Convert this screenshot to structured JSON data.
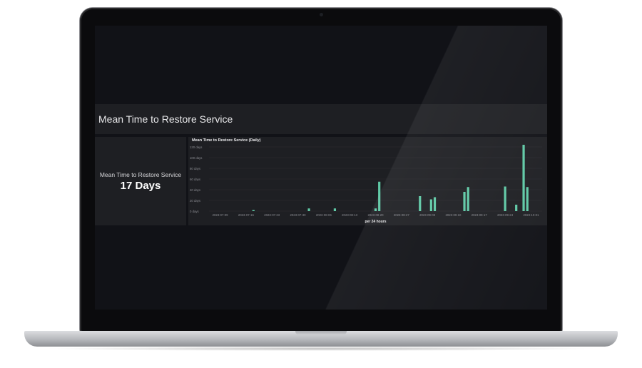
{
  "dashboard": {
    "header_title": "Mean Time to Restore Service",
    "stat": {
      "label": "Mean Time to Restore Service",
      "value": "17 Days"
    },
    "chart_title": "Mean Time to Restore Service (Daily)"
  },
  "colors": {
    "bar": "#5fc9a6",
    "panel": "#1e1f23",
    "background": "#111217"
  },
  "chart_data": {
    "type": "bar",
    "title": "Mean Time to Restore Service (Daily)",
    "xlabel": "per 24 hours",
    "ylabel": "",
    "y_unit": "days",
    "ylim": [
      0,
      120
    ],
    "yticks": [
      "0 days",
      "20 days",
      "40 days",
      "60 days",
      "80 days",
      "100 days",
      "120 days"
    ],
    "ytick_values": [
      0,
      20,
      40,
      60,
      80,
      100,
      120
    ],
    "xtick_labels": [
      "2023-07-09",
      "2023-07-16",
      "2023-07-23",
      "2023-07-30",
      "2023-08-06",
      "2023-08-13",
      "2023-08-20",
      "2023-08-27",
      "2023-09-03",
      "2023-09-10",
      "2023-09-17",
      "2023-09-24",
      "2023-10-01"
    ],
    "x_range": [
      "2023-07-06",
      "2023-10-04"
    ],
    "series": [
      {
        "values": [
          {
            "date": "2023-07-18",
            "value": 2
          },
          {
            "date": "2023-08-02",
            "value": 5
          },
          {
            "date": "2023-08-09",
            "value": 5
          },
          {
            "date": "2023-08-20",
            "value": 5
          },
          {
            "date": "2023-08-21",
            "value": 55
          },
          {
            "date": "2023-09-01",
            "value": 28
          },
          {
            "date": "2023-09-04",
            "value": 22
          },
          {
            "date": "2023-09-05",
            "value": 26
          },
          {
            "date": "2023-09-13",
            "value": 36
          },
          {
            "date": "2023-09-14",
            "value": 45
          },
          {
            "date": "2023-09-24",
            "value": 46
          },
          {
            "date": "2023-09-27",
            "value": 12
          },
          {
            "date": "2023-09-29",
            "value": 124
          },
          {
            "date": "2023-09-30",
            "value": 45
          }
        ]
      }
    ]
  }
}
